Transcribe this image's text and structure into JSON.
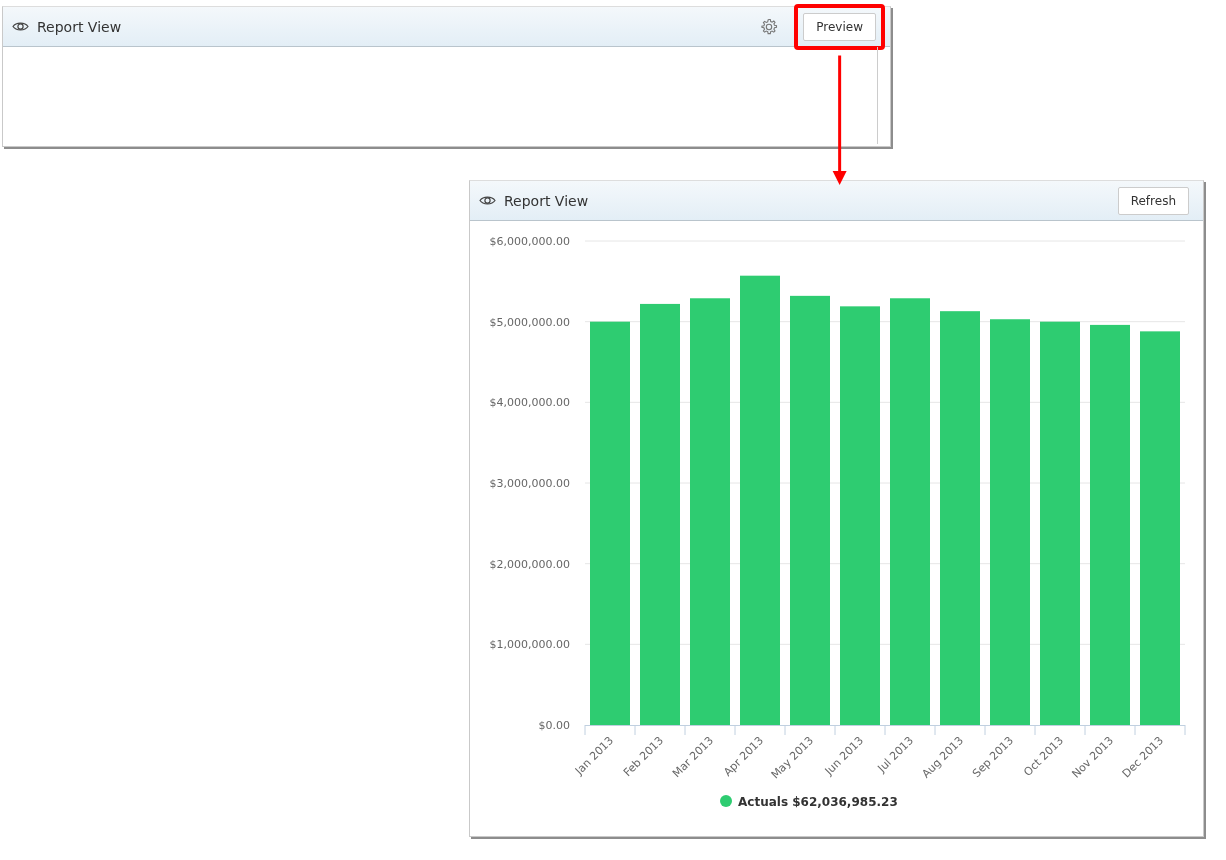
{
  "panels": [
    {
      "title": "Report View",
      "settings": true,
      "button": "Preview",
      "highlighted": true
    },
    {
      "title": "Report View",
      "settings": false,
      "button": "Refresh",
      "highlighted": false,
      "chart_data": {
        "type": "bar",
        "categories": [
          "Jan 2013",
          "Feb 2013",
          "Mar 2013",
          "Apr 2013",
          "May 2013",
          "Jun 2013",
          "Jul 2013",
          "Aug 2013",
          "Sep 2013",
          "Oct 2013",
          "Nov 2013",
          "Dec 2013"
        ],
        "series": [
          {
            "name": "Actuals $62,036,985.23",
            "color": "#2ecc71",
            "values": [
              5000000,
              5220000,
              5290000,
              5570000,
              5320000,
              5190000,
              5290000,
              5130000,
              5030000,
              5000000,
              4960000,
              4880000
            ]
          }
        ],
        "ylim": [
          0,
          6000000
        ],
        "grid": true,
        "yticks": [
          {
            "value": 0,
            "label": "$0.00"
          },
          {
            "value": 1000000,
            "label": "$1,000,000.00"
          },
          {
            "value": 2000000,
            "label": "$2,000,000.00"
          },
          {
            "value": 3000000,
            "label": "$3,000,000.00"
          },
          {
            "value": 4000000,
            "label": "$4,000,000.00"
          },
          {
            "value": 5000000,
            "label": "$5,000,000.00"
          },
          {
            "value": 6000000,
            "label": "$6,000,000.00"
          }
        ]
      }
    }
  ]
}
